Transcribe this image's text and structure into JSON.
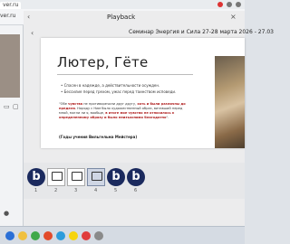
{
  "browser": {
    "tab_label": "ver.ru",
    "url_fragment": "ver.ru"
  },
  "playback": {
    "title": "Playback",
    "back_glyph": "‹",
    "close_glyph": "×",
    "chevron_glyph": "‹",
    "presentation_title": "Семинар Энергия и Сила 27-28 марта 2026 - 27.03"
  },
  "slide": {
    "title": "Лютер, Гёте",
    "bullets": [
      "Спасен в надежде, а действительности осужден.",
      "Бессилие перед грехом, ужас перед таинством исповеди."
    ],
    "quote_parts": [
      "\"Обе ",
      "чувства",
      " не противоречили друг другу, ",
      "хоть и были различны до предела",
      ". Наряду с Ним было художественный образ, витавший перед мной, могли ли я, вообще, ",
      "в итоге мое чувство не относилось к определенному образу и было неизъяснимо благодатно",
      "\"."
    ],
    "source": "(Годы учения Вильгельма Мейстера)"
  },
  "thumbnails": [
    {
      "type": "logo",
      "letter": "b",
      "number": "1"
    },
    {
      "type": "monitor",
      "number": "2"
    },
    {
      "type": "monitor",
      "number": "3"
    },
    {
      "type": "monitor",
      "number": "4",
      "selected": true
    },
    {
      "type": "logo",
      "letter": "b",
      "number": "5"
    },
    {
      "type": "logo",
      "letter": "b",
      "number": "6"
    }
  ],
  "colors": {
    "brand_logo": "#1b2a5e",
    "highlight": "#b02020"
  }
}
